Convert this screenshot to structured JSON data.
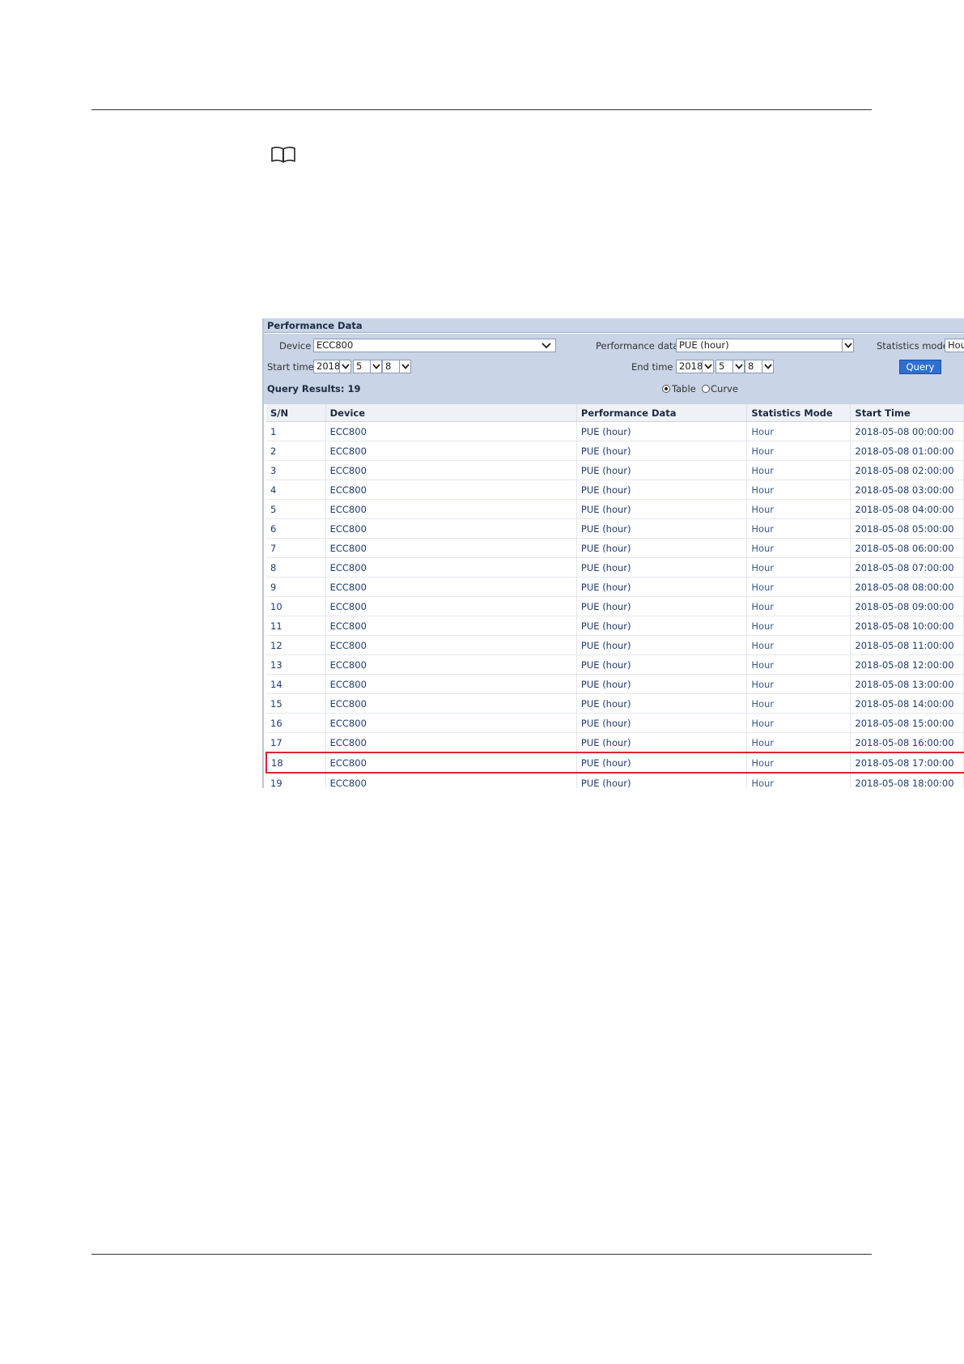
{
  "panel": {
    "title": "Performance Data",
    "device_label": "Device",
    "device_value": "ECC800",
    "perf_label": "Performance data",
    "perf_value": "PUE (hour)",
    "stats_label": "Statistics mode",
    "stats_value": "Hou",
    "start_label": "Start time",
    "start_year": "2018",
    "start_month": "5",
    "start_day": "8",
    "end_label": "End time",
    "end_year": "2018",
    "end_month": "5",
    "end_day": "8",
    "query_button": "Query",
    "results_label": "Query Results: 19",
    "view_table": "Table",
    "view_curve": "Curve",
    "selected_view": "Table"
  },
  "table": {
    "headers": [
      "S/N",
      "Device",
      "Performance Data",
      "Statistics Mode",
      "Start Time"
    ],
    "highlighted_row": 18,
    "rows": [
      [
        "1",
        "ECC800",
        "PUE (hour)",
        "Hour",
        "2018-05-08 00:00:00"
      ],
      [
        "2",
        "ECC800",
        "PUE (hour)",
        "Hour",
        "2018-05-08 01:00:00"
      ],
      [
        "3",
        "ECC800",
        "PUE (hour)",
        "Hour",
        "2018-05-08 02:00:00"
      ],
      [
        "4",
        "ECC800",
        "PUE (hour)",
        "Hour",
        "2018-05-08 03:00:00"
      ],
      [
        "5",
        "ECC800",
        "PUE (hour)",
        "Hour",
        "2018-05-08 04:00:00"
      ],
      [
        "6",
        "ECC800",
        "PUE (hour)",
        "Hour",
        "2018-05-08 05:00:00"
      ],
      [
        "7",
        "ECC800",
        "PUE (hour)",
        "Hour",
        "2018-05-08 06:00:00"
      ],
      [
        "8",
        "ECC800",
        "PUE (hour)",
        "Hour",
        "2018-05-08 07:00:00"
      ],
      [
        "9",
        "ECC800",
        "PUE (hour)",
        "Hour",
        "2018-05-08 08:00:00"
      ],
      [
        "10",
        "ECC800",
        "PUE (hour)",
        "Hour",
        "2018-05-08 09:00:00"
      ],
      [
        "11",
        "ECC800",
        "PUE (hour)",
        "Hour",
        "2018-05-08 10:00:00"
      ],
      [
        "12",
        "ECC800",
        "PUE (hour)",
        "Hour",
        "2018-05-08 11:00:00"
      ],
      [
        "13",
        "ECC800",
        "PUE (hour)",
        "Hour",
        "2018-05-08 12:00:00"
      ],
      [
        "14",
        "ECC800",
        "PUE (hour)",
        "Hour",
        "2018-05-08 13:00:00"
      ],
      [
        "15",
        "ECC800",
        "PUE (hour)",
        "Hour",
        "2018-05-08 14:00:00"
      ],
      [
        "16",
        "ECC800",
        "PUE (hour)",
        "Hour",
        "2018-05-08 15:00:00"
      ],
      [
        "17",
        "ECC800",
        "PUE (hour)",
        "Hour",
        "2018-05-08 16:00:00"
      ],
      [
        "18",
        "ECC800",
        "PUE (hour)",
        "Hour",
        "2018-05-08 17:00:00"
      ],
      [
        "19",
        "ECC800",
        "PUE (hour)",
        "Hour",
        "2018-05-08 18:00:00"
      ]
    ]
  },
  "icons": {
    "note": "book-icon",
    "dropdown": "chevron-down-icon"
  },
  "colors": {
    "panel_bg": "#c9d5e6",
    "button_bg": "#2f6fd0",
    "highlight": "#e0242d",
    "cell_text": "#1f3b6e"
  }
}
